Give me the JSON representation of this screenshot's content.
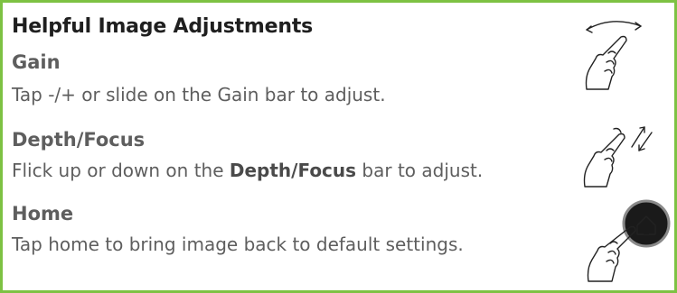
{
  "title": "Helpful Image Adjustments",
  "sections": [
    {
      "heading": "Gain",
      "description": "Tap -/+ or slide on the Gain bar to adjust.",
      "gesture_icon": "hand-swipe-arc-icon"
    },
    {
      "heading": "Depth/Focus",
      "description_before": "Flick up or down on the ",
      "description_bold": "Depth/Focus",
      "description_after": " bar to adjust.",
      "gesture_icon": "hand-flick-icon"
    },
    {
      "heading": "Home",
      "description": "Tap home to bring image back to default settings.",
      "gesture_icon": "hand-tap-home-icon"
    }
  ],
  "colors": {
    "border": "#7dc243",
    "title_text": "#1f1f1f",
    "body_text": "#5e5e5e",
    "home_button": "#1a1a1a"
  }
}
